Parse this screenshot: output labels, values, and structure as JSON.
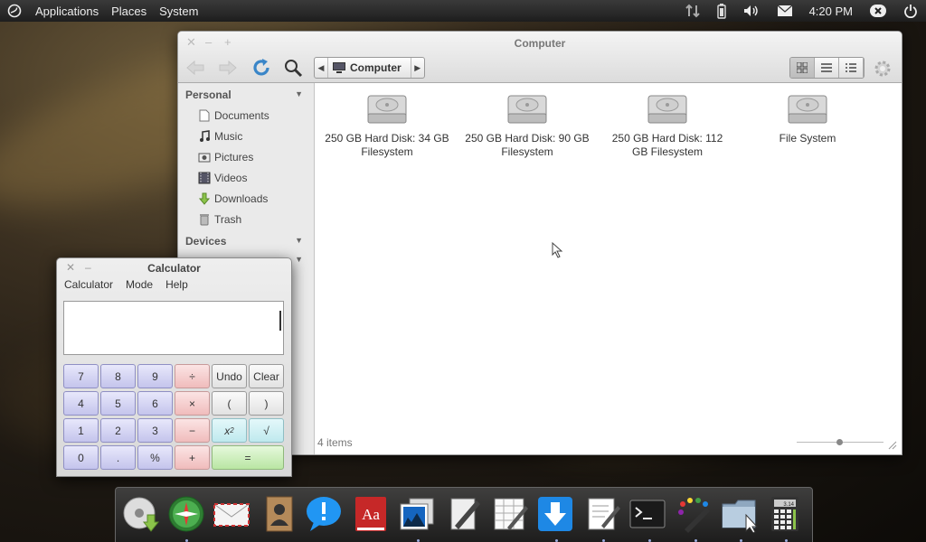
{
  "panel": {
    "menus": [
      "Applications",
      "Places",
      "System"
    ],
    "clock": "4:20 PM"
  },
  "file_manager": {
    "title": "Computer",
    "location": "Computer",
    "sidebar": {
      "personal_header": "Personal",
      "personal_items": [
        "Documents",
        "Music",
        "Pictures",
        "Videos",
        "Downloads",
        "Trash"
      ],
      "devices_header": "Devices"
    },
    "drives": [
      {
        "label": "250 GB Hard Disk: 34 GB Filesystem"
      },
      {
        "label": "250 GB Hard Disk: 90 GB Filesystem"
      },
      {
        "label": "250 GB Hard Disk: 112 GB Filesystem"
      },
      {
        "label": "File System"
      }
    ],
    "status": "4 items"
  },
  "calculator": {
    "title": "Calculator",
    "menus": [
      "Calculator",
      "Mode",
      "Help"
    ],
    "display": "",
    "keys": {
      "seven": "7",
      "eight": "8",
      "nine": "9",
      "divide": "÷",
      "undo": "Undo",
      "clear": "Clear",
      "four": "4",
      "five": "5",
      "six": "6",
      "multiply": "×",
      "lparen": "(",
      "rparen": ")",
      "one": "1",
      "two": "2",
      "three": "3",
      "minus": "−",
      "square_base": "x",
      "square_exp": "2",
      "sqrt": "√",
      "zero": "0",
      "point": ".",
      "percent": "%",
      "plus": "+",
      "equals": "="
    }
  },
  "dock": {
    "apps": [
      "cd-install-icon",
      "web-browser-icon",
      "mail-icon",
      "contacts-icon",
      "chat-icon",
      "dictionary-icon",
      "photos-icon",
      "notes-icon",
      "spreadsheet-icon",
      "downloader-icon",
      "text-editor-icon",
      "terminal-icon",
      "paint-icon",
      "files-icon",
      "calculator-icon"
    ],
    "calculator_display": "3.14"
  }
}
